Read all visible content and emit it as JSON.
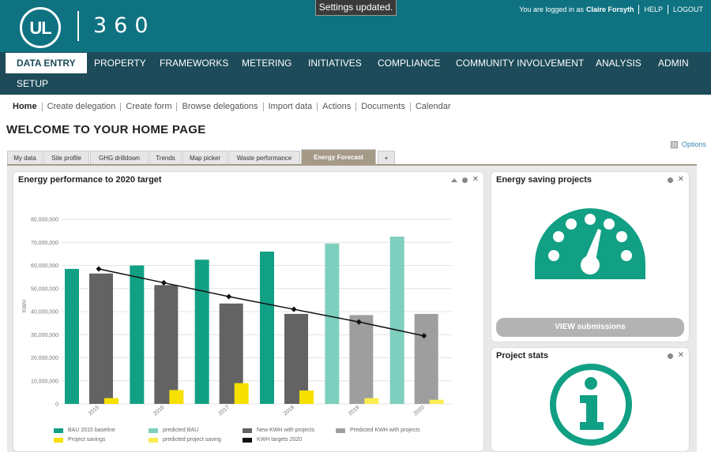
{
  "header": {
    "logo_text": "UL",
    "product_name": "360",
    "toast": "Settings updated.",
    "logged_in_prefix": "You are logged in as",
    "user_name": "Claire Forsyth",
    "help_label": "HELP",
    "logout_label": "LOGOUT"
  },
  "main_nav": {
    "items": [
      {
        "label": "DATA ENTRY",
        "active": true
      },
      {
        "label": "PROPERTY"
      },
      {
        "label": "FRAMEWORKS"
      },
      {
        "label": "METERING"
      },
      {
        "label": "INITIATIVES"
      },
      {
        "label": "COMPLIANCE"
      },
      {
        "label": "COMMUNITY INVOLVEMENT"
      },
      {
        "label": "ANALYSIS"
      },
      {
        "label": "ADMIN"
      },
      {
        "label": "SETUP"
      }
    ]
  },
  "sub_nav": {
    "items": [
      "Home",
      "Create delegation",
      "Create form",
      "Browse delegations",
      "Import data",
      "Actions",
      "Documents",
      "Calendar"
    ]
  },
  "page": {
    "title": "WELCOME TO YOUR HOME PAGE",
    "options_label": "Options"
  },
  "tabs": {
    "items": [
      "My data",
      "Site profile",
      "GHG drilldown",
      "Trends",
      "Map picker",
      "Waste performance",
      "Energy Forecast",
      "+"
    ],
    "active_index": 6
  },
  "panels": {
    "energy_performance": {
      "title": "Energy performance to 2020 target"
    },
    "energy_saving": {
      "title": "Energy saving projects",
      "button_label": "VIEW submissions"
    },
    "project_stats": {
      "title": "Project stats"
    }
  },
  "icons": {
    "gauge": "gauge-icon",
    "info": "info-icon",
    "collapse": "collapse-icon",
    "settings": "gear-icon",
    "close": "close-icon",
    "options": "options-icon"
  },
  "colors": {
    "header_bg": "#0e7281",
    "nav_bg": "#1d4b59",
    "teal": "#12a084",
    "teal_light": "#7ecfbd",
    "dark_grey": "#636363",
    "grey": "#9e9e9e",
    "yellow": "#f5e000",
    "accent_icon": "#12a084",
    "tab_active": "#a59a88"
  },
  "chart_data": {
    "type": "bar",
    "title": "Energy performance to 2020 target",
    "ylabel": "KWH",
    "ylim": [
      0,
      80000000
    ],
    "yticks": [
      "0",
      "10,000,000",
      "20,000,000",
      "30,000,000",
      "40,000,000",
      "50,000,000",
      "60,000,000",
      "70,000,000",
      "80,000,000"
    ],
    "categories": [
      "2015",
      "2016",
      "2017",
      "2018",
      "2019",
      "2020"
    ],
    "series": [
      {
        "name": "BAU 2015 baseline",
        "color": "#12a084",
        "values": [
          58500000,
          60000000,
          62500000,
          66000000,
          null,
          null
        ]
      },
      {
        "name": "predicted BAU",
        "color": "#7ecfbd",
        "values": [
          null,
          null,
          null,
          null,
          69500000,
          72500000
        ]
      },
      {
        "name": "New KWH with projects",
        "color": "#636363",
        "values": [
          56500000,
          51500000,
          43500000,
          39000000,
          null,
          null
        ]
      },
      {
        "name": "Predicted KWH with projects",
        "color": "#9e9e9e",
        "values": [
          null,
          null,
          null,
          null,
          38500000,
          39000000
        ]
      },
      {
        "name": "Project savings",
        "color": "#f5e000",
        "values": [
          2500000,
          6000000,
          9000000,
          5800000,
          null,
          null
        ]
      },
      {
        "name": "predicted project saving",
        "color": "#fbed50",
        "values": [
          null,
          null,
          null,
          null,
          2500000,
          1800000
        ]
      },
      {
        "name": "KWH targets 2020",
        "color": "#111111",
        "type": "line",
        "values": [
          58500000,
          52500000,
          46500000,
          41000000,
          35500000,
          29500000
        ]
      }
    ],
    "grid": true,
    "legend": "bottom"
  }
}
